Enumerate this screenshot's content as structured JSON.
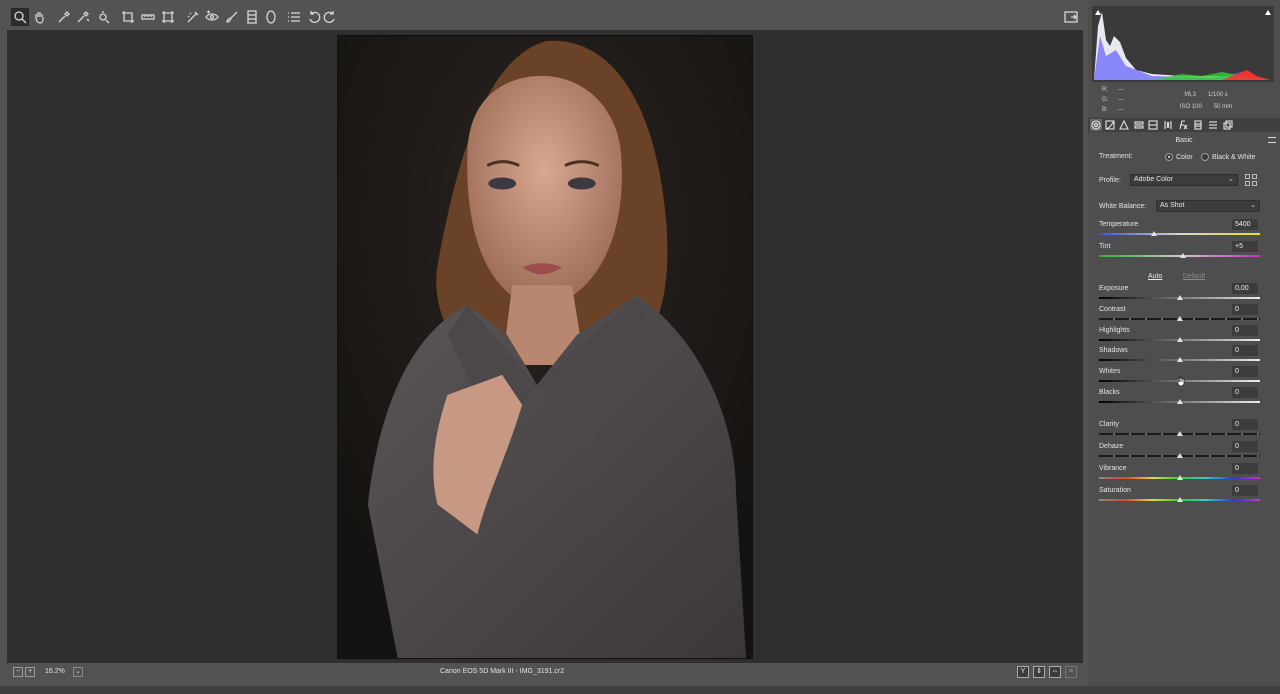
{
  "toolbar": {
    "tools": [
      "zoom-tool-icon",
      "hand-tool-icon",
      "white-balance-tool-icon",
      "color-sampler-icon",
      "targeted-adjustment-icon",
      "crop-tool-icon",
      "straighten-tool-icon",
      "transform-tool-icon",
      "spot-removal-icon",
      "red-eye-icon",
      "adjustment-brush-icon",
      "graduated-filter-icon",
      "radial-filter-icon",
      "presets-list-icon",
      "rotate-ccw-icon",
      "rotate-cw-icon"
    ]
  },
  "histogram": {
    "readout": {
      "r_label": "R:",
      "g_label": "G:",
      "b_label": "B:",
      "r": "---",
      "g": "---",
      "b": "---"
    },
    "exif": {
      "aperture": "f/6,3",
      "shutter": "1/100 s",
      "iso": "ISO 100",
      "focal": "50 mm"
    }
  },
  "panel": {
    "title": "Basic",
    "treatment_label": "Treatment:",
    "treatment_color": "Color",
    "treatment_bw": "Black & White",
    "profile_label": "Profile:",
    "profile_value": "Adobe Color",
    "wb_label": "White Balance:",
    "wb_value": "As Shot",
    "auto": "Auto",
    "default": "Default",
    "sliders": {
      "temperature": {
        "label": "Temperature",
        "value": "5400",
        "level": 0.34
      },
      "tint": {
        "label": "Tint",
        "value": "+5",
        "level": 0.52
      },
      "exposure": {
        "label": "Exposure",
        "value": "0,00",
        "level": 0.5
      },
      "contrast": {
        "label": "Contrast",
        "value": "0",
        "level": 0.5
      },
      "highlights": {
        "label": "Highlights",
        "value": "0",
        "level": 0.5
      },
      "shadows": {
        "label": "Shadows",
        "value": "0",
        "level": 0.5
      },
      "whites": {
        "label": "Whites",
        "value": "0",
        "level": 0.5
      },
      "blacks": {
        "label": "Blacks",
        "value": "0",
        "level": 0.5
      },
      "clarity": {
        "label": "Clarity",
        "value": "0",
        "level": 0.5
      },
      "dehaze": {
        "label": "Dehaze",
        "value": "0",
        "level": 0.5
      },
      "vibrance": {
        "label": "Vibrance",
        "value": "0",
        "level": 0.5
      },
      "saturation": {
        "label": "Saturation",
        "value": "0",
        "level": 0.5
      }
    }
  },
  "status": {
    "zoom": "16.2%",
    "filename": "Canon EOS 5D Mark III  -  IMG_3191.cr2",
    "view_y": "Y",
    "view_compare": "⇕",
    "view_swap": "⇔"
  }
}
